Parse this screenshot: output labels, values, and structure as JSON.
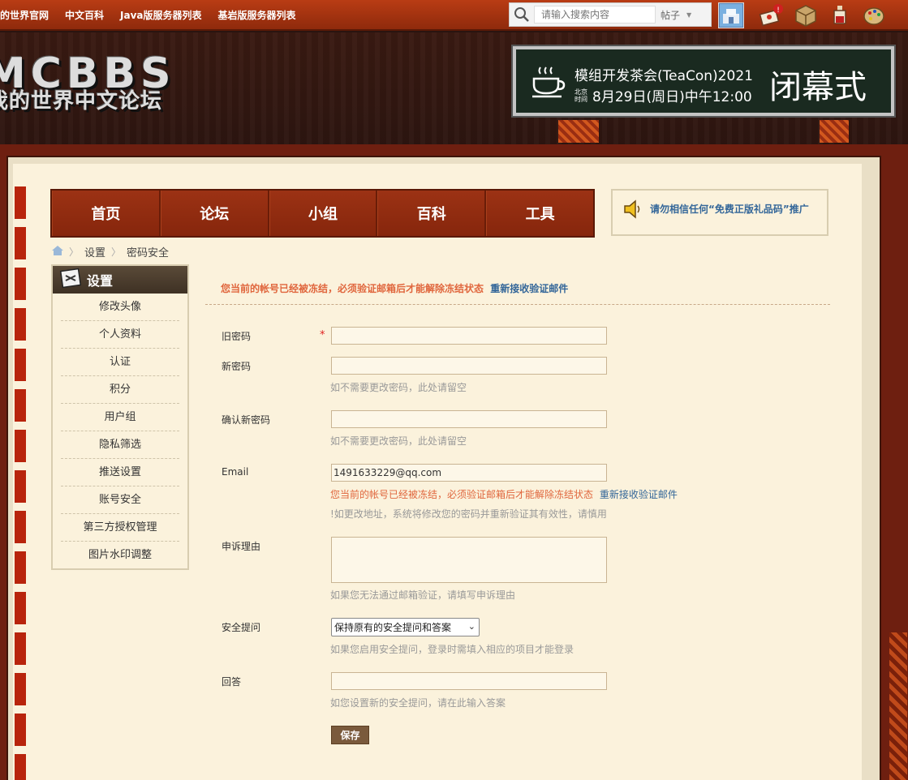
{
  "topbar": {
    "links": [
      "的世界官网",
      "中文百科",
      "Java版服务器列表",
      "基岩版服务器列表"
    ],
    "search_placeholder": "请输入搜索内容",
    "search_type": "帖子",
    "notify_count": "!"
  },
  "header": {
    "logo_big": "MCBBS",
    "logo_small": "我的世界中文论坛",
    "teacon": {
      "title": "模组开发茶会(TeaCon)2021",
      "tz_line1": "北京",
      "tz_line2": "时间",
      "date": "8月29日(周日)中午12:00",
      "ceremony": "闭幕式"
    }
  },
  "mainnav": [
    "首页",
    "论坛",
    "小组",
    "百科",
    "工具"
  ],
  "notice": "请勿相信任何“免费正版礼品码”推广",
  "breadcrumb": [
    "设置",
    "密码安全"
  ],
  "sidebar": {
    "title": "设置",
    "items": [
      "修改头像",
      "个人资料",
      "认证",
      "积分",
      "用户组",
      "隐私筛选",
      "推送设置",
      "账号安全",
      "第三方授权管理",
      "图片水印调整"
    ]
  },
  "form": {
    "freeze_msg": "您当前的帐号已经被冻结，必须验证邮箱后才能解除冻结状态",
    "resend_link": "重新接收验证邮件",
    "old_password_label": "旧密码",
    "required_mark": "*",
    "new_password_label": "新密码",
    "new_password_tip": "如不需要更改密码，此处请留空",
    "confirm_password_label": "确认新密码",
    "confirm_password_tip": "如不需要更改密码，此处请留空",
    "email_label": "Email",
    "email_value": "1491633229@qq.com",
    "email_freeze_msg": "您当前的帐号已经被冻结，必须验证邮箱后才能解除冻结状态",
    "email_resend_link": "重新接收验证邮件",
    "email_tip": "!如更改地址，系统将修改您的密码并重新验证其有效性，请慎用",
    "appeal_label": "申诉理由",
    "appeal_tip": "如果您无法通过邮箱验证，请填写申诉理由",
    "question_label": "安全提问",
    "question_selected": "保持原有的安全提问和答案",
    "question_tip": "如果您启用安全提问，登录时需填入相应的项目才能登录",
    "answer_label": "回答",
    "answer_tip": "如您设置新的安全提问，请在此输入答案",
    "save_label": "保存"
  }
}
